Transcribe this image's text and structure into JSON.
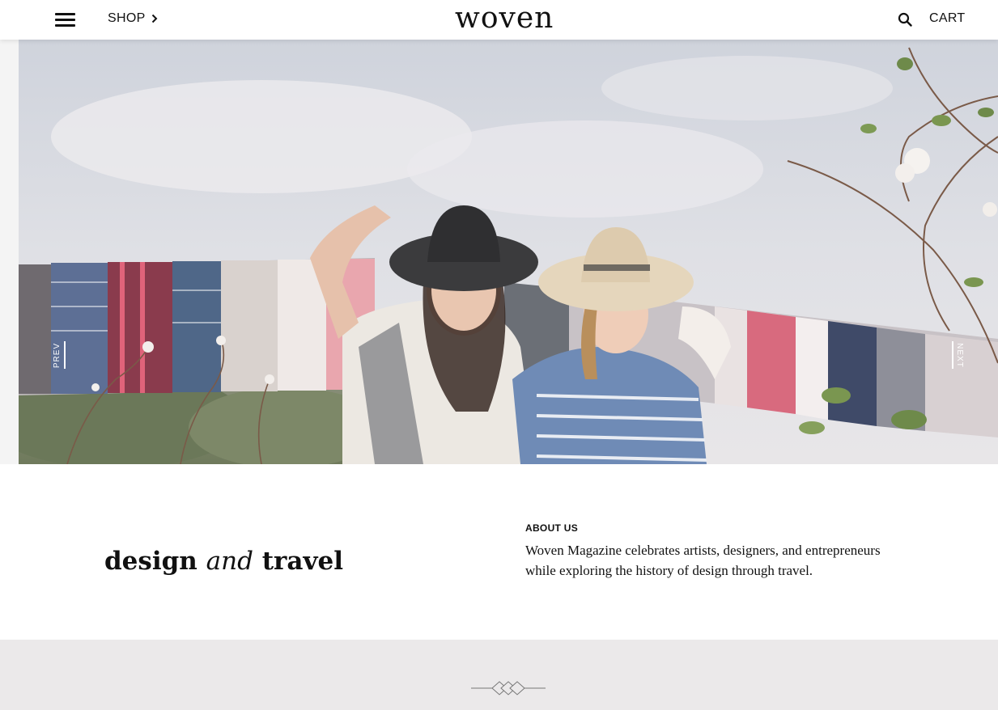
{
  "header": {
    "shop_label": "SHOP",
    "logo": "woven",
    "cart_label": "CART"
  },
  "icons": {
    "menu": "hamburger-menu-icon",
    "shop_chevron": "chevron-right-icon",
    "search": "search-icon",
    "ornament": "diamond-divider-icon"
  },
  "hero": {
    "prev_label": "PREV",
    "next_label": "NEXT"
  },
  "intro": {
    "tagline_part1": "design",
    "tagline_part2": "and",
    "tagline_part3": "travel",
    "about_heading": "ABOUT US",
    "about_line1": "Woven Magazine celebrates artists, designers, and entrepreneurs",
    "about_line2": "while exploring the history of design through travel."
  },
  "colors": {
    "band_background": "#ebe9ea",
    "text": "#111111",
    "header_background": "#ffffff"
  }
}
